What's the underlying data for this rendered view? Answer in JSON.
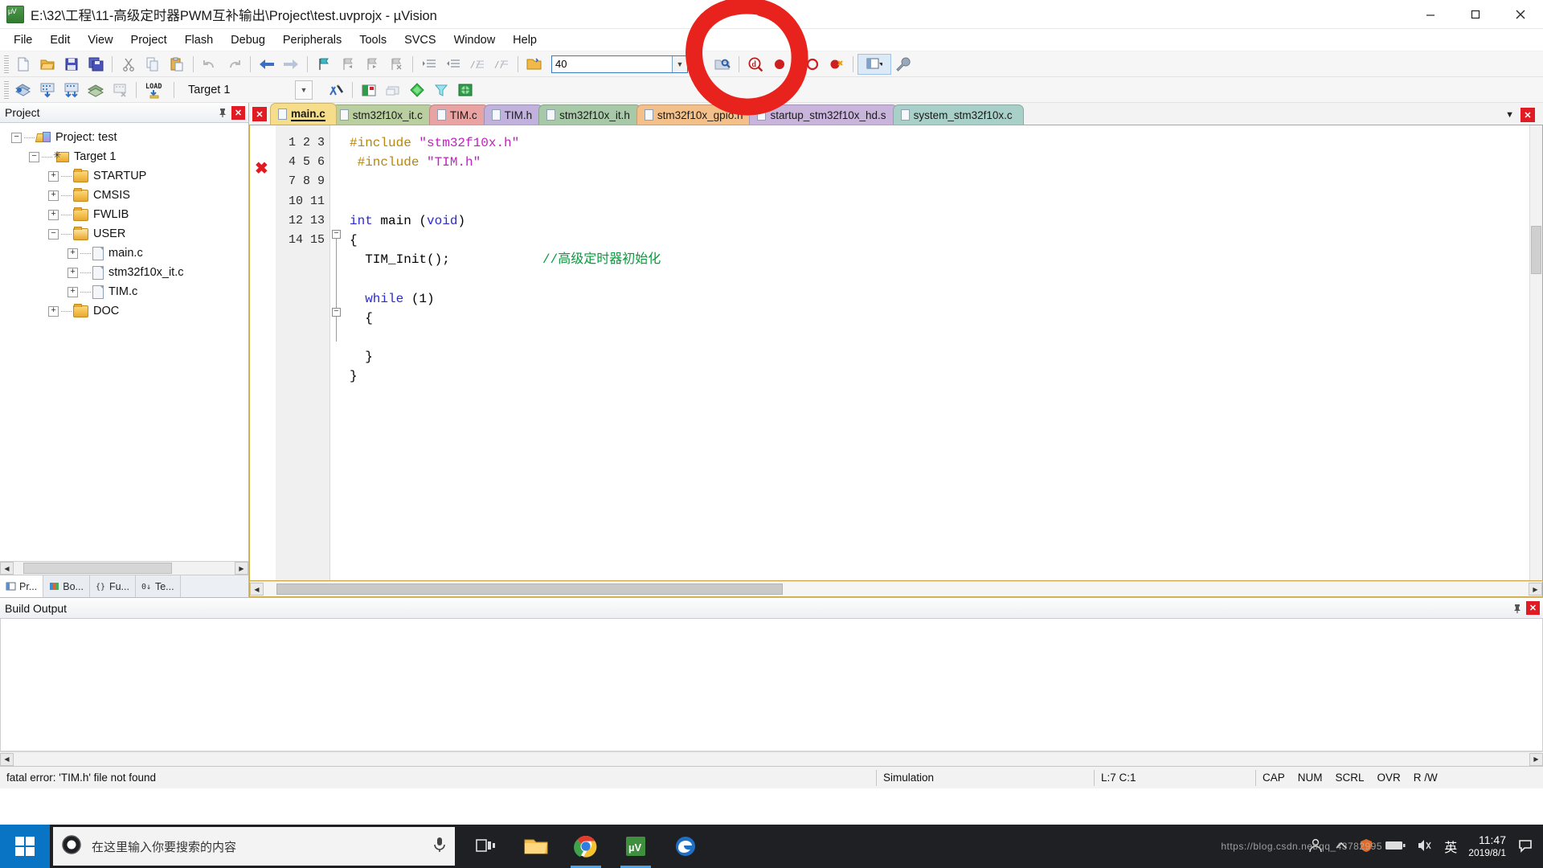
{
  "window": {
    "title": "E:\\32\\工程\\11-高级定时器PWM互补输出\\Project\\test.uvprojx - µVision",
    "app_icon": "uvision-icon",
    "minimize": "minimize-icon",
    "maximize": "maximize-icon",
    "close": "close-icon"
  },
  "menu": {
    "items": [
      {
        "label": "File"
      },
      {
        "label": "Edit"
      },
      {
        "label": "View"
      },
      {
        "label": "Project"
      },
      {
        "label": "Flash"
      },
      {
        "label": "Debug"
      },
      {
        "label": "Peripherals"
      },
      {
        "label": "Tools"
      },
      {
        "label": "SVCS"
      },
      {
        "label": "Window"
      },
      {
        "label": "Help"
      }
    ]
  },
  "toolbar1": {
    "buttons": [
      {
        "name": "new-file-icon",
        "title": "New"
      },
      {
        "name": "open-file-icon",
        "title": "Open"
      },
      {
        "name": "save-icon",
        "title": "Save"
      },
      {
        "name": "save-all-icon",
        "title": "Save All"
      },
      {
        "name": "cut-icon",
        "title": "Cut"
      },
      {
        "name": "copy-icon",
        "title": "Copy"
      },
      {
        "name": "paste-icon",
        "title": "Paste"
      },
      {
        "name": "undo-icon",
        "title": "Undo"
      },
      {
        "name": "redo-icon",
        "title": "Redo"
      },
      {
        "name": "navigate-back-icon",
        "title": "Back"
      },
      {
        "name": "navigate-forward-icon",
        "title": "Forward"
      },
      {
        "name": "bookmark-toggle-icon",
        "title": "Insert/Remove Bookmark"
      },
      {
        "name": "bookmark-prev-icon",
        "title": "Previous Bookmark"
      },
      {
        "name": "bookmark-next-icon",
        "title": "Next Bookmark"
      },
      {
        "name": "bookmark-clear-icon",
        "title": "Clear All Bookmarks"
      },
      {
        "name": "indent-right-icon",
        "title": "Indent"
      },
      {
        "name": "indent-left-icon",
        "title": "Outdent"
      },
      {
        "name": "comment-icon",
        "title": "Comment"
      },
      {
        "name": "uncomment-icon",
        "title": "Uncomment"
      },
      {
        "name": "open-file-browse-icon",
        "title": "Open File"
      }
    ],
    "search_value": "40",
    "search_placeholder": "",
    "search_dropdown_icon": "chevron-down-icon",
    "right_buttons": [
      {
        "name": "find-in-files-icon",
        "title": "Find in Files"
      },
      {
        "name": "debug-zoom-icon",
        "title": "Start/Stop Debug"
      },
      {
        "name": "breakpoint-icon",
        "title": "Insert/Remove Breakpoint"
      },
      {
        "name": "disable-breakpoint-icon",
        "title": "Disable Breakpoint"
      },
      {
        "name": "kill-breakpoints-icon",
        "title": "Kill All Breakpoints"
      },
      {
        "name": "window-layout-icon",
        "title": "Window Layout"
      },
      {
        "name": "configure-icon",
        "title": "Configuration"
      }
    ]
  },
  "toolbar2": {
    "buttons": [
      {
        "name": "translate-icon",
        "title": "Translate"
      },
      {
        "name": "build-icon",
        "title": "Build"
      },
      {
        "name": "rebuild-icon",
        "title": "Rebuild"
      },
      {
        "name": "batch-build-icon",
        "title": "Batch Build"
      },
      {
        "name": "stop-build-icon",
        "title": "Stop Build"
      },
      {
        "name": "download-icon",
        "title": "Download"
      }
    ],
    "target_value": "Target 1",
    "target_dropdown_icon": "chevron-down-icon",
    "right_buttons": [
      {
        "name": "target-options-icon",
        "title": "Options for Target"
      },
      {
        "name": "manage-project-icon",
        "title": "Manage Project Items"
      },
      {
        "name": "multi-project-icon",
        "title": "Multi-Project"
      },
      {
        "name": "pack-installer-icon",
        "title": "Pack Installer"
      },
      {
        "name": "run-to-main-icon",
        "title": "Run to Main"
      },
      {
        "name": "source-browse-icon",
        "title": "Source Browse"
      }
    ]
  },
  "project_panel": {
    "title": "Project",
    "pin_icon": "pin-icon",
    "close_icon": "close-icon",
    "tree": [
      {
        "label": "Project: test",
        "icon": "project-icon",
        "expander": "-",
        "indent": 0
      },
      {
        "label": "Target 1",
        "icon": "target-icon",
        "expander": "-",
        "indent": 1
      },
      {
        "label": "STARTUP",
        "icon": "folder-icon",
        "expander": "+",
        "indent": 2
      },
      {
        "label": "CMSIS",
        "icon": "folder-icon",
        "expander": "+",
        "indent": 2
      },
      {
        "label": "FWLIB",
        "icon": "folder-icon",
        "expander": "+",
        "indent": 2
      },
      {
        "label": "USER",
        "icon": "folder-open-icon",
        "expander": "-",
        "indent": 2
      },
      {
        "label": "main.c",
        "icon": "file-icon",
        "expander": "+",
        "indent": 3
      },
      {
        "label": "stm32f10x_it.c",
        "icon": "file-icon",
        "expander": "+",
        "indent": 3
      },
      {
        "label": "TIM.c",
        "icon": "file-icon",
        "expander": "+",
        "indent": 3
      },
      {
        "label": "DOC",
        "icon": "folder-icon",
        "expander": "+",
        "indent": 2
      }
    ],
    "bottom_tabs": [
      {
        "label": "Pr...",
        "icon": "project-tab-icon",
        "active": true
      },
      {
        "label": "Bo...",
        "icon": "books-tab-icon",
        "active": false
      },
      {
        "label": "Fu...",
        "icon": "functions-tab-icon",
        "active": false
      },
      {
        "label": "Te...",
        "icon": "templates-tab-icon",
        "active": false
      }
    ],
    "scroll_left_icon": "chevron-left-icon",
    "scroll_right_icon": "chevron-right-icon"
  },
  "editor": {
    "close_tab_icon": "close-icon",
    "tabs": [
      {
        "label": "main.c",
        "color": "#f6dd8a",
        "active": true
      },
      {
        "label": "stm32f10x_it.c",
        "color": "#b9cfa0",
        "active": false
      },
      {
        "label": "TIM.c",
        "color": "#e9a3a3",
        "active": false
      },
      {
        "label": "TIM.h",
        "color": "#c1b1dd",
        "active": false
      },
      {
        "label": "stm32f10x_it.h",
        "color": "#a8c9a8",
        "active": false
      },
      {
        "label": "stm32f10x_gpio.h",
        "color": "#f4c08a",
        "active": false
      },
      {
        "label": "startup_stm32f10x_hd.s",
        "color": "#c9b4dc",
        "active": false
      },
      {
        "label": "system_stm32f10x.c",
        "color": "#a9cfc9",
        "active": false
      }
    ],
    "tab_scroll_icon": "chevron-down-icon",
    "tab_close_icon": "close-icon",
    "error_marker_icon": "error-marker-icon",
    "line_numbers": [
      "1",
      "2",
      "3",
      "4",
      "5",
      "6",
      "7",
      "8",
      "9",
      "10",
      "11",
      "12",
      "13",
      "14",
      "15"
    ],
    "code_lines": [
      {
        "n": 1,
        "tokens": [
          {
            "t": "#include ",
            "c": "pp"
          },
          {
            "t": "\"stm32f10x.h\"",
            "c": "str"
          }
        ]
      },
      {
        "n": 2,
        "tokens": [
          {
            "t": " #include ",
            "c": "pp"
          },
          {
            "t": "\"TIM.h\"",
            "c": "str"
          }
        ]
      },
      {
        "n": 3,
        "tokens": []
      },
      {
        "n": 4,
        "tokens": []
      },
      {
        "n": 5,
        "tokens": [
          {
            "t": "int",
            "c": "kw"
          },
          {
            "t": " main (",
            "c": "plain"
          },
          {
            "t": "void",
            "c": "kw"
          },
          {
            "t": ")",
            "c": "plain"
          }
        ]
      },
      {
        "n": 6,
        "tokens": [
          {
            "t": "{",
            "c": "plain"
          }
        ]
      },
      {
        "n": 7,
        "tokens": [
          {
            "t": "  TIM_Init();",
            "c": "plain"
          },
          {
            "t": "            //高级定时器初始化",
            "c": "cmt"
          }
        ]
      },
      {
        "n": 8,
        "tokens": []
      },
      {
        "n": 9,
        "tokens": [
          {
            "t": "  ",
            "c": "plain"
          },
          {
            "t": "while",
            "c": "kw"
          },
          {
            "t": " (1)",
            "c": "plain"
          }
        ]
      },
      {
        "n": 10,
        "tokens": [
          {
            "t": "  {",
            "c": "plain"
          }
        ]
      },
      {
        "n": 11,
        "tokens": []
      },
      {
        "n": 12,
        "tokens": [
          {
            "t": "  }",
            "c": "plain"
          }
        ]
      },
      {
        "n": 13,
        "tokens": [
          {
            "t": "}",
            "c": "plain"
          }
        ]
      },
      {
        "n": 14,
        "tokens": []
      },
      {
        "n": 15,
        "tokens": []
      }
    ]
  },
  "build_output": {
    "title": "Build Output",
    "pin_icon": "pin-icon",
    "close_icon": "close-icon",
    "content": ""
  },
  "statusbar": {
    "message": "fatal error: 'TIM.h' file not found",
    "simulation": "Simulation",
    "cursor": "L:7 C:1",
    "cap": "CAP",
    "num": "NUM",
    "scrl": "SCRL",
    "ovr": "OVR",
    "rw": "R /W"
  },
  "taskbar": {
    "start_icon": "windows-start-icon",
    "search_icon": "cortana-circle-icon",
    "search_placeholder": "在这里输入你要搜索的内容",
    "mic_icon": "microphone-icon",
    "task_view_icon": "task-view-icon",
    "apps": [
      {
        "name": "file-explorer-icon",
        "active": false
      },
      {
        "name": "chrome-icon",
        "active": true
      },
      {
        "name": "uvision-icon",
        "active": true
      },
      {
        "name": "edge-icon",
        "active": false
      }
    ],
    "tray": [
      {
        "name": "people-icon"
      },
      {
        "name": "chevron-up-icon"
      },
      {
        "name": "security-icon"
      },
      {
        "name": "battery-icon"
      },
      {
        "name": "volume-icon"
      },
      {
        "name": "ime-icon",
        "label": "英"
      }
    ],
    "time": "11:47",
    "date": "2019/8/1"
  },
  "annotation": {
    "shape": "red-circle-highlight",
    "color": "#e8231e"
  },
  "watermark": "https://blog.csdn.net/qq_43782995"
}
